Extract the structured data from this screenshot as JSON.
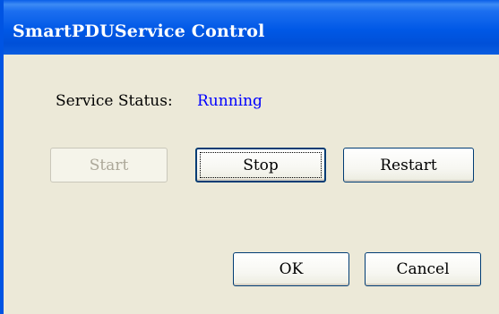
{
  "window": {
    "title": "SmartPDUService Control"
  },
  "status": {
    "label": "Service Status:",
    "value": "Running",
    "value_color": "#0000ff"
  },
  "controls": {
    "start_label": "Start",
    "start_enabled": false,
    "stop_label": "Stop",
    "stop_focused": true,
    "restart_label": "Restart"
  },
  "footer": {
    "ok_label": "OK",
    "cancel_label": "Cancel"
  },
  "colors": {
    "titlebar": "#0054e3",
    "dialog_background": "#ece9d8",
    "button_border": "#003c74"
  }
}
